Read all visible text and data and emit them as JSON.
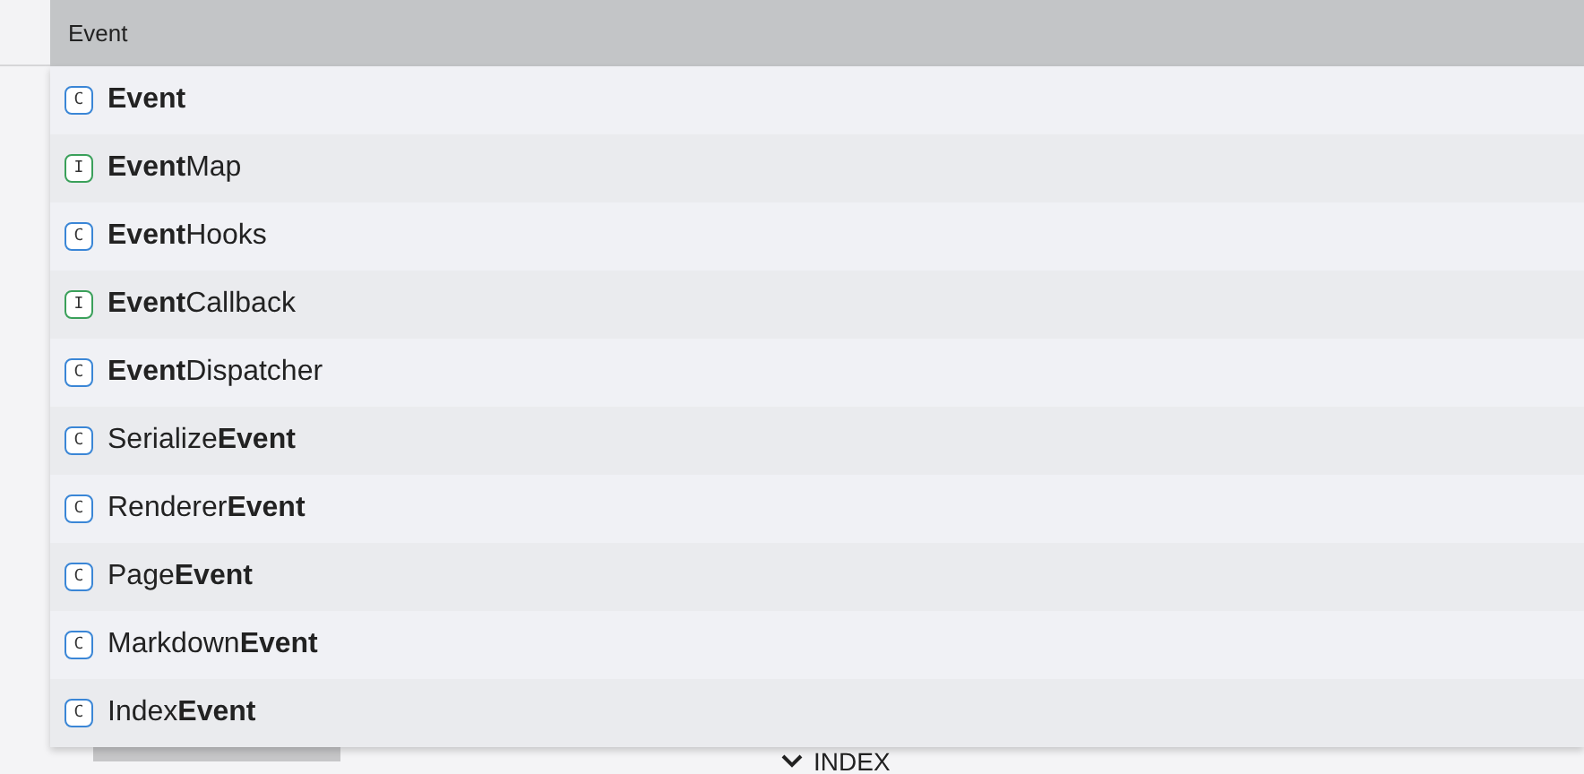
{
  "search": {
    "value": "Event"
  },
  "results": [
    {
      "kind": "class",
      "badge": "C",
      "label": "**Event**"
    },
    {
      "kind": "interface",
      "badge": "I",
      "label": "**Event**Map"
    },
    {
      "kind": "class",
      "badge": "C",
      "label": "**Event**Hooks"
    },
    {
      "kind": "interface",
      "badge": "I",
      "label": "**Event**Callback"
    },
    {
      "kind": "class",
      "badge": "C",
      "label": "**Event**Dispatcher"
    },
    {
      "kind": "class",
      "badge": "C",
      "label": "Serialize**Event**"
    },
    {
      "kind": "class",
      "badge": "C",
      "label": "Renderer**Event**"
    },
    {
      "kind": "class",
      "badge": "C",
      "label": "Page**Event**"
    },
    {
      "kind": "class",
      "badge": "C",
      "label": "Markdown**Event**"
    },
    {
      "kind": "class",
      "badge": "C",
      "label": "Index**Event**"
    }
  ],
  "section": {
    "title": "INDEX",
    "expanded": true
  }
}
